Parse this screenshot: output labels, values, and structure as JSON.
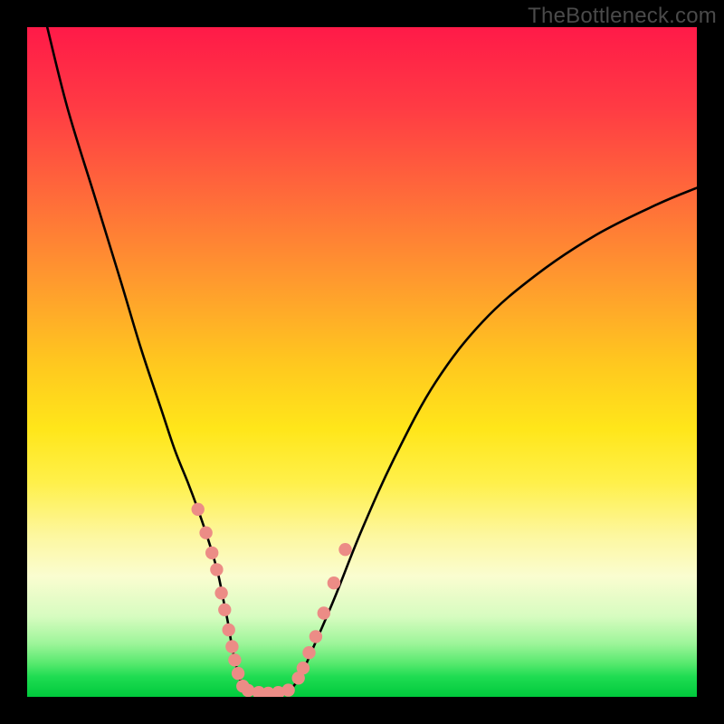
{
  "watermark": "TheBottleneck.com",
  "chart_data": {
    "type": "line",
    "title": "",
    "xlabel": "",
    "ylabel": "",
    "xlim": [
      0,
      100
    ],
    "ylim": [
      0,
      100
    ],
    "series": [
      {
        "name": "left-branch",
        "x": [
          3,
          6,
          10,
          14,
          17,
          20,
          22,
          24,
          25.5,
          26.7,
          27.8,
          28.6,
          29.3,
          30,
          30.5,
          31,
          31.5,
          32,
          32.5
        ],
        "y": [
          100,
          88,
          75,
          62,
          52,
          43,
          37,
          32,
          28,
          24.5,
          21,
          18,
          14.5,
          11,
          8,
          5.5,
          3.5,
          2,
          1.2
        ]
      },
      {
        "name": "valley-floor",
        "x": [
          32.5,
          34,
          36,
          38,
          39.5
        ],
        "y": [
          1.2,
          0.7,
          0.55,
          0.7,
          1.2
        ]
      },
      {
        "name": "right-branch",
        "x": [
          39.5,
          41,
          43,
          46,
          50,
          55,
          61,
          68,
          76,
          85,
          94,
          100
        ],
        "y": [
          1.2,
          3.5,
          8,
          15,
          25,
          36,
          47,
          56,
          63,
          69,
          73.5,
          76
        ]
      }
    ],
    "markers_left": {
      "name": "left-branch-points",
      "x": [
        25.5,
        26.7,
        27.6,
        28.3,
        29.0,
        29.5,
        30.1,
        30.6,
        31.0,
        31.5,
        32.2
      ],
      "y": [
        28.0,
        24.5,
        21.5,
        19.0,
        15.5,
        13.0,
        10.0,
        7.5,
        5.5,
        3.5,
        1.6
      ]
    },
    "markers_right": {
      "name": "right-branch-points",
      "x": [
        40.5,
        41.2,
        42.1,
        43.1,
        44.3,
        45.8,
        47.5
      ],
      "y": [
        2.8,
        4.3,
        6.6,
        9.0,
        12.5,
        17.0,
        22.0
      ]
    },
    "markers_floor": {
      "name": "valley-floor-points",
      "x": [
        33.0,
        34.6,
        36.0,
        37.5,
        39.0
      ],
      "y": [
        0.95,
        0.65,
        0.55,
        0.65,
        1.0
      ]
    },
    "gradient_stops": [
      {
        "pos": 0,
        "color": "#ff1a48"
      },
      {
        "pos": 12,
        "color": "#ff3b44"
      },
      {
        "pos": 25,
        "color": "#ff6a3a"
      },
      {
        "pos": 38,
        "color": "#ff9a2e"
      },
      {
        "pos": 50,
        "color": "#ffc71f"
      },
      {
        "pos": 60,
        "color": "#ffe61a"
      },
      {
        "pos": 68,
        "color": "#fff04a"
      },
      {
        "pos": 76,
        "color": "#fdf7a0"
      },
      {
        "pos": 82,
        "color": "#fafdd0"
      },
      {
        "pos": 88,
        "color": "#d7fcc0"
      },
      {
        "pos": 92,
        "color": "#9ef59a"
      },
      {
        "pos": 95,
        "color": "#57e96e"
      },
      {
        "pos": 97,
        "color": "#1fdc52"
      },
      {
        "pos": 100,
        "color": "#00c93c"
      }
    ]
  }
}
